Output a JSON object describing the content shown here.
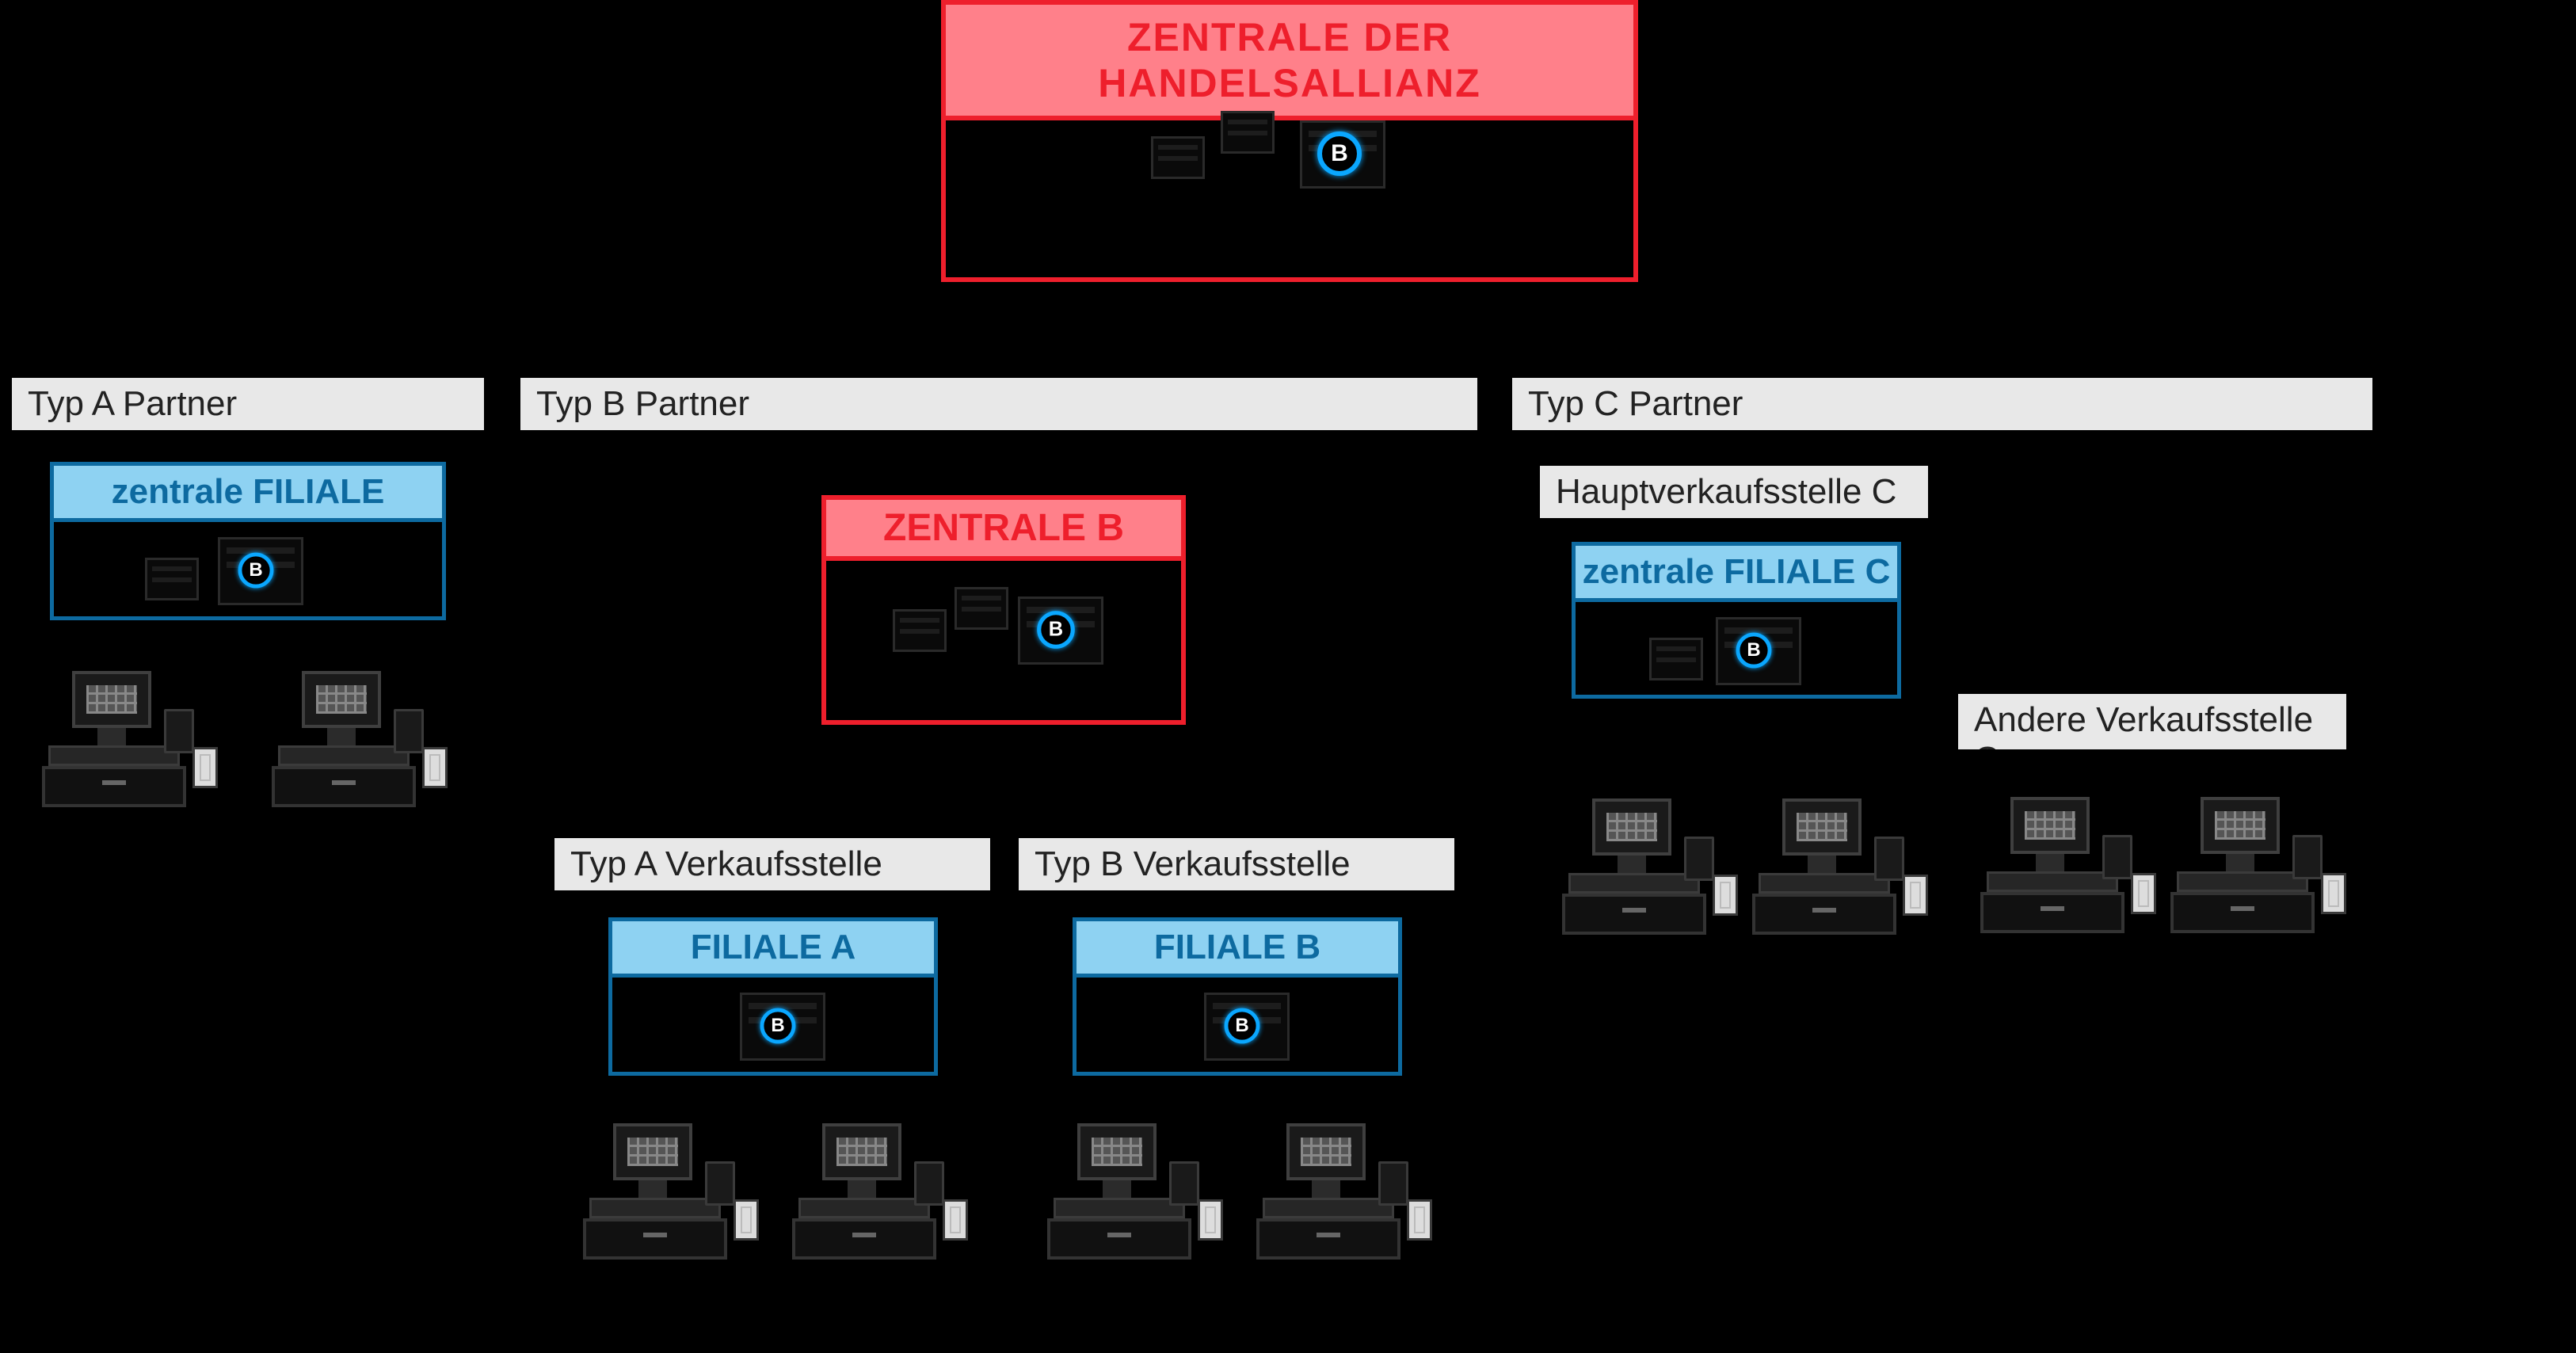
{
  "zentrale": {
    "title": "ZENTRALE DER HANDELSALLIANZ"
  },
  "partnerA": {
    "title": "Typ A Partner",
    "central": {
      "title": "zentrale FILIALE"
    }
  },
  "partnerB": {
    "title": "Typ B Partner",
    "zentrale": {
      "title": "ZENTRALE B"
    },
    "storeA": {
      "title": "Typ A Verkaufsstelle",
      "filiale": "FILIALE A"
    },
    "storeB": {
      "title": "Typ B Verkaufsstelle",
      "filiale": "FILIALE B"
    }
  },
  "partnerC": {
    "title": "Typ C Partner",
    "main": {
      "title": "Hauptverkaufsstelle C",
      "filiale": "zentrale FILIALE C"
    },
    "other": {
      "title": "Andere Verkaufsstelle C"
    }
  }
}
